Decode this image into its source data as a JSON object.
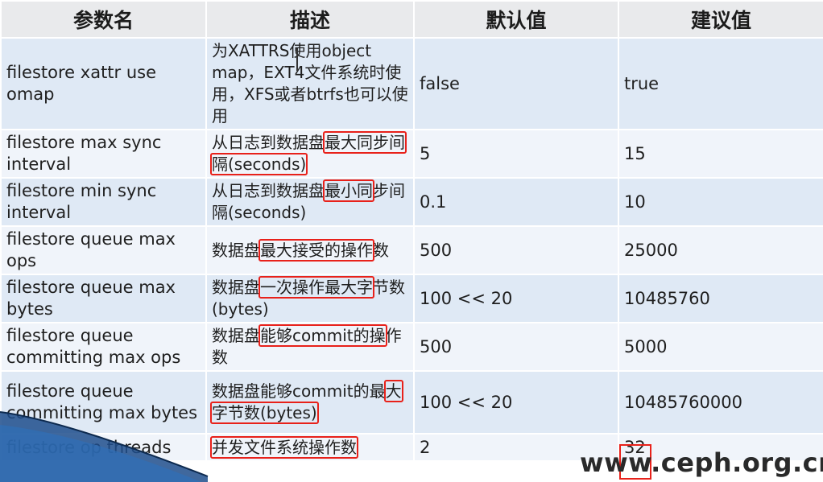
{
  "headers": [
    "参数名",
    "描述",
    "默认值",
    "建议值"
  ],
  "rows": [
    {
      "name": "filestore xattr use omap",
      "desc_plain": "为XATTRS使用object map，EXT4文件系统时使用，XFS或者btrfs也可以使用",
      "desc_highlight": "",
      "desc_tail": "",
      "default": "false",
      "suggested": "true"
    },
    {
      "name": "filestore max sync interval",
      "desc_plain": "从日志到数据盘",
      "desc_highlight": "最大同步间隔(seconds)",
      "desc_tail": "",
      "default": "5",
      "suggested": "15"
    },
    {
      "name": "filestore min sync interval",
      "desc_plain": "从日志到数据盘",
      "desc_highlight": "最小同",
      "desc_tail": "步间隔(seconds)",
      "default": "0.1",
      "suggested": "10"
    },
    {
      "name": "filestore queue max ops",
      "desc_plain": "数据盘",
      "desc_highlight": "最大接受的操作",
      "desc_tail": "数",
      "default": "500",
      "suggested": "25000"
    },
    {
      "name": "filestore queue max bytes",
      "desc_plain": "数据盘",
      "desc_highlight": "一次操作最大字",
      "desc_tail": "节数(bytes)",
      "default": "100 << 20",
      "suggested": "10485760"
    },
    {
      "name": "filestore queue committing max ops",
      "desc_plain": "数据盘",
      "desc_highlight": "能够commit的操",
      "desc_tail": "作数",
      "default": "500",
      "suggested": "5000"
    },
    {
      "name": "filestore queue committing max bytes",
      "desc_plain": "数据盘能够commit的最",
      "desc_highlight": "大字节数(bytes)",
      "desc_tail": "",
      "default": "100 << 20",
      "suggested": "10485760000"
    },
    {
      "name": "filestore op threads",
      "desc_plain": "",
      "desc_highlight": "并发文件系统操作数",
      "desc_tail": "",
      "default": "2",
      "suggested": "32"
    }
  ],
  "watermark": "www.ceph.org.cn",
  "colors": {
    "header_bg": "#e9eaec",
    "row_bg": "#dfe9f5",
    "row_alt_bg": "#f0f4fa",
    "highlight_border": "#e8211a",
    "swoosh": "#1f4e8c"
  }
}
